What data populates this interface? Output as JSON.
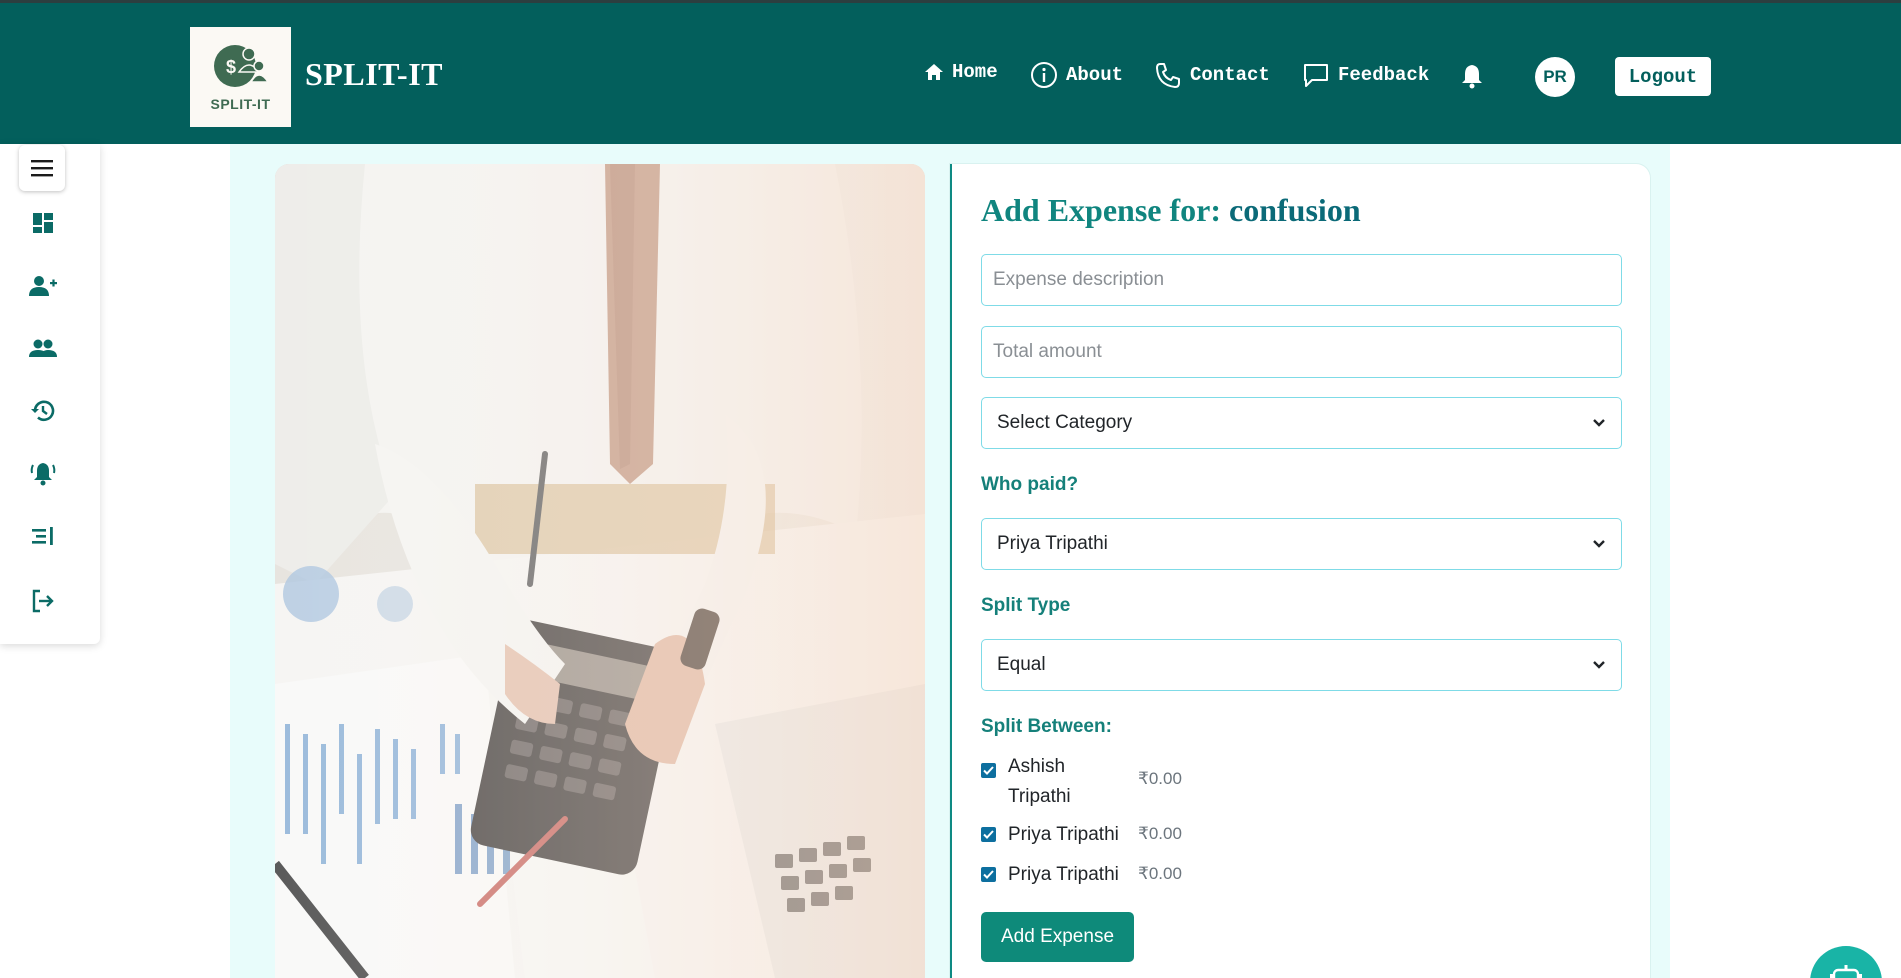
{
  "header": {
    "logo_text": "SPLIT-IT",
    "brand": "SPLIT-IT",
    "nav": {
      "home": "Home",
      "about": "About",
      "contact": "Contact",
      "feedback": "Feedback"
    },
    "avatar_initials": "PR",
    "logout_label": "Logout",
    "icons": [
      "home-icon",
      "info-icon",
      "phone-icon",
      "chat-icon",
      "bell-icon"
    ]
  },
  "sidebar": {
    "items": [
      "menu-icon",
      "dashboard-icon",
      "add-user-icon",
      "group-icon",
      "history-icon",
      "notifications-icon",
      "collapse-icon",
      "logout-icon"
    ]
  },
  "form": {
    "title_prefix": "Add Expense for: ",
    "group_name": "confusion",
    "description_placeholder": "Expense description",
    "description_value": "",
    "amount_placeholder": "Total amount",
    "amount_value": "",
    "category_selected": "Select Category",
    "who_paid_label": "Who paid?",
    "who_paid_selected": "Priya Tripathi",
    "split_type_label": "Split Type",
    "split_type_selected": "Equal",
    "split_between_label": "Split Between:",
    "members": [
      {
        "name_line1": "Ashish",
        "name_line2": "Tripathi",
        "amount": "₹0.00",
        "checked": true
      },
      {
        "name": "Priya Tripathi",
        "amount": "₹0.00",
        "checked": true
      },
      {
        "name": "Priya Tripathi",
        "amount": "₹0.00",
        "checked": true
      }
    ],
    "submit_label": "Add Expense"
  },
  "colors": {
    "topbar": "#035f5c",
    "accent": "#10857f",
    "button": "#0e8a7a",
    "input_border": "#7fdbe7",
    "checkbox": "#0d6f9f",
    "fab": "#19b4a6"
  }
}
